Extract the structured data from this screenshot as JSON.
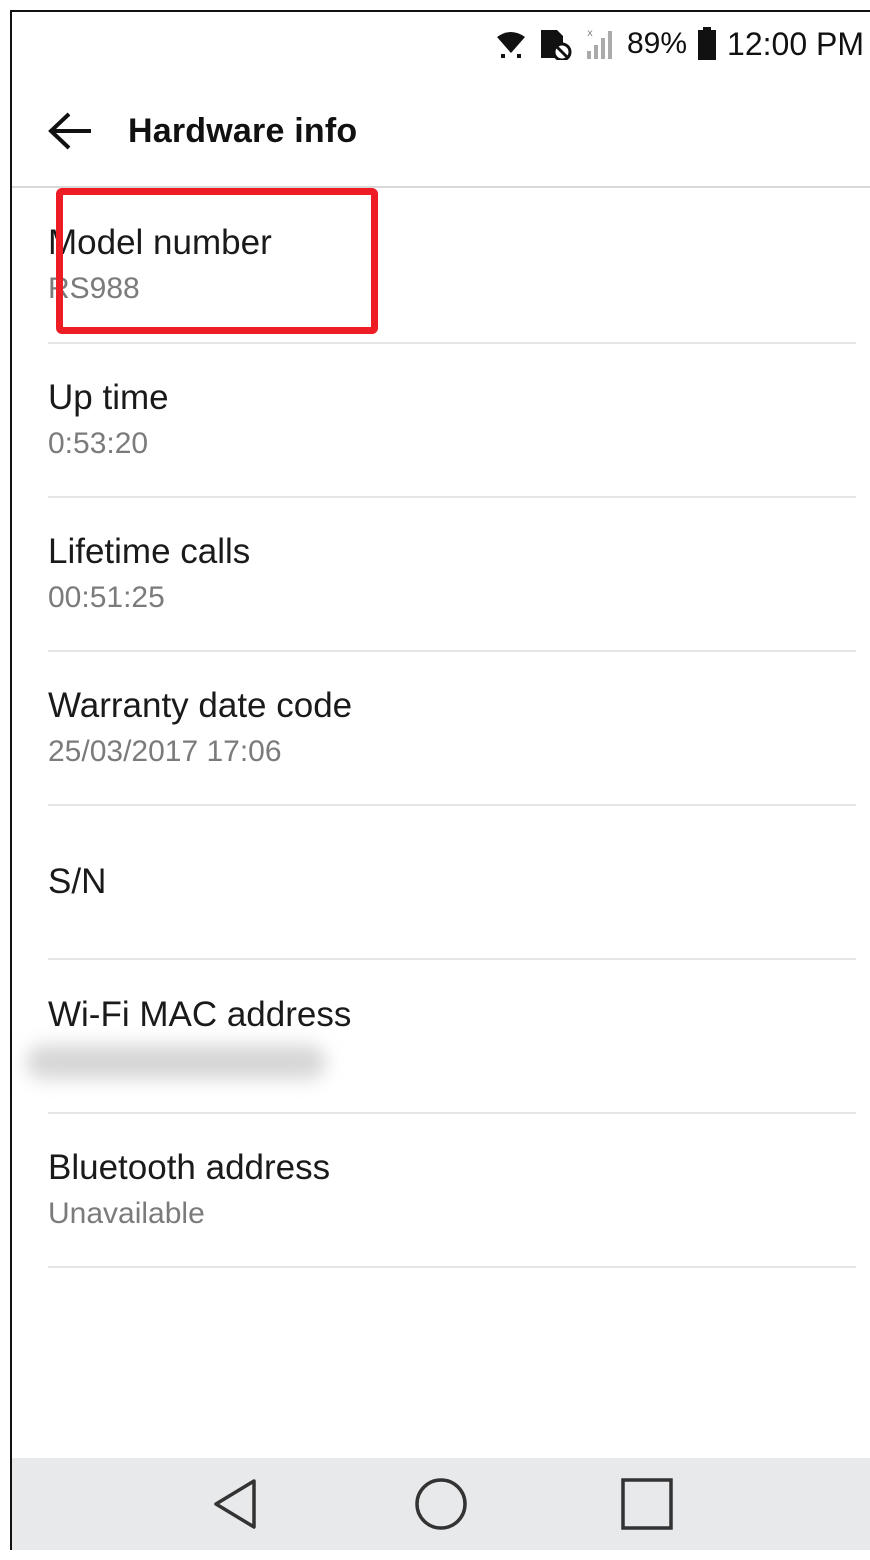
{
  "status_bar": {
    "battery_percent": "89%",
    "time": "12:00 PM",
    "icons": [
      "wifi-icon",
      "nfc-icon",
      "signal-icon",
      "battery-icon"
    ]
  },
  "app_bar": {
    "title": "Hardware info",
    "back_icon": "arrow-left-icon"
  },
  "items": [
    {
      "label": "Model number",
      "value": "RS988"
    },
    {
      "label": "Up time",
      "value": "0:53:20"
    },
    {
      "label": "Lifetime calls",
      "value": "00:51:25"
    },
    {
      "label": "Warranty date code",
      "value": "25/03/2017 17:06"
    },
    {
      "label": "S/N",
      "value": ""
    },
    {
      "label": "Wi-Fi MAC address",
      "value": ""
    },
    {
      "label": "Bluetooth address",
      "value": "Unavailable"
    }
  ],
  "highlight_color": "#ee1c24",
  "nav_bar": {
    "icons": [
      "back-triangle-icon",
      "home-circle-icon",
      "recents-square-icon"
    ]
  }
}
